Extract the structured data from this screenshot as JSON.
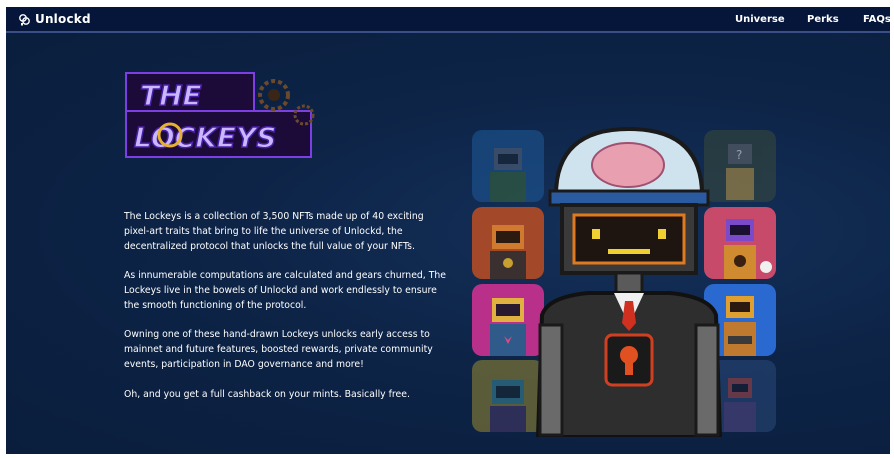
{
  "nav": {
    "brand": "Unlockd",
    "links": [
      "Universe",
      "Perks",
      "FAQs"
    ]
  },
  "logo": {
    "line1": "THE",
    "line2": "LOCKEYS"
  },
  "content": {
    "paragraphs": [
      "The Lockeys is a collection of 3,500 NFTs made up of 40 exciting pixel-art traits that bring to life the universe of Unlockd, the decentralized protocol that unlocks the full value of your NFTs.",
      "As innumerable computations are calculated and gears churned, The Lockeys live in the bowels of Unlockd and work endlessly to ensure the smooth functioning of the protocol.",
      "Owning one of these hand-drawn Lockeys unlocks early access to mainnet and future features, boosted rewards, private community events, participation in DAO governance and more!",
      "Oh, and you get a full cashback on your mints. Basically free."
    ]
  },
  "colors": {
    "background": "#0d2447",
    "navbar": "#06163a",
    "accent_purple": "#7b3fe4",
    "text": "#ffffff"
  },
  "icons": {
    "brand_icon": "unlockd-key-icon"
  }
}
